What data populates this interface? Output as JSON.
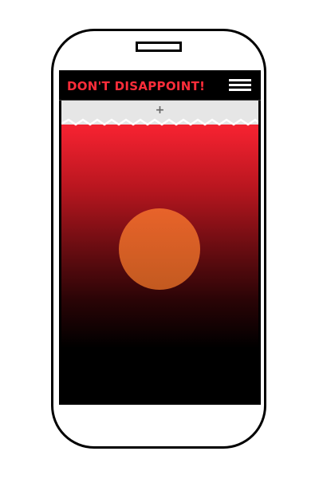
{
  "app": {
    "title": "DON'T DISAPPOINT!",
    "menu_icon": "hamburger-menu-icon",
    "add_icon_glyph": "+",
    "add_icon": "plus-icon"
  },
  "colors": {
    "title_red": "#ff2d3a",
    "header_bg": "#000000",
    "add_bar_bg": "#e6e6e6",
    "gradient_top": "#ff2433",
    "gradient_bottom": "#000000",
    "circle_top": "#e8632a",
    "circle_bottom": "#c35a20"
  }
}
